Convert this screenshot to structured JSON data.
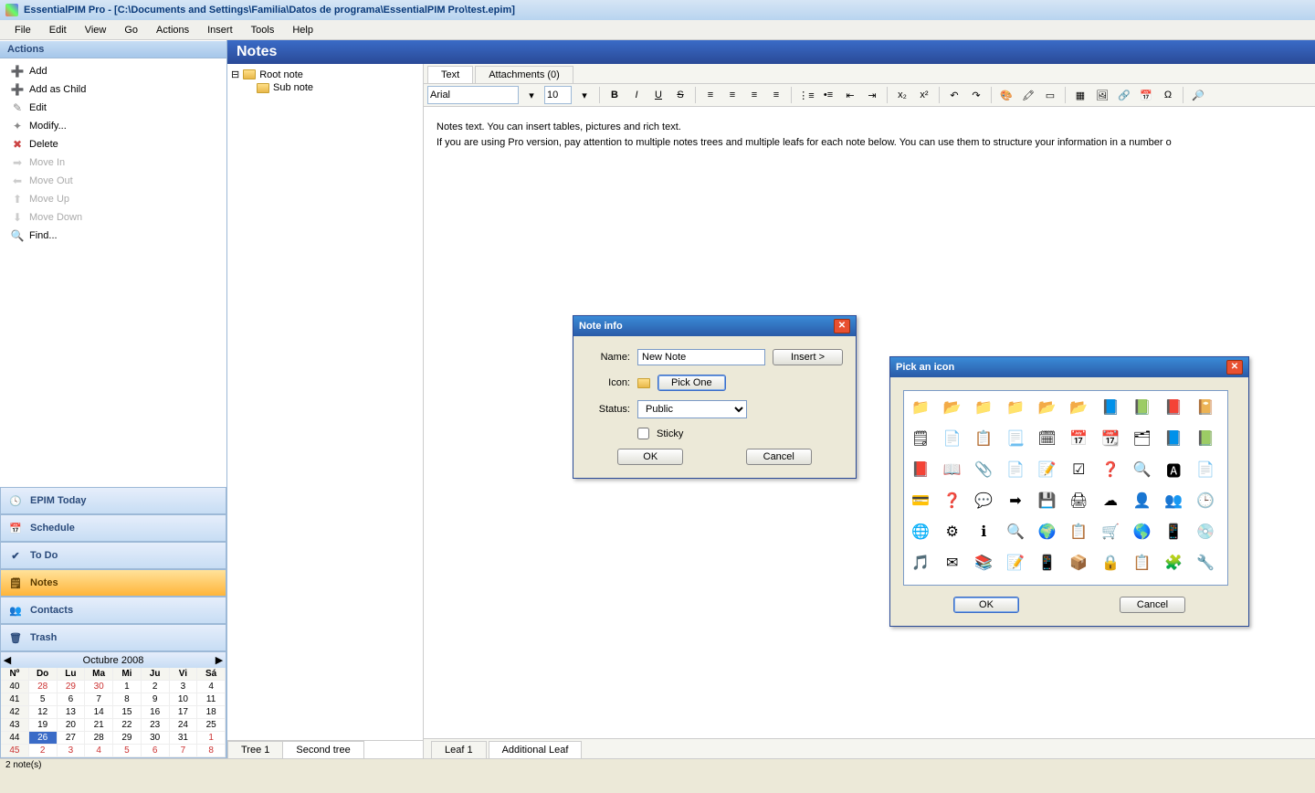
{
  "window": {
    "title": "EssentialPIM Pro - [C:\\Documents and Settings\\Familia\\Datos de programa\\EssentialPIM Pro\\test.epim]"
  },
  "menubar": [
    "File",
    "Edit",
    "View",
    "Go",
    "Actions",
    "Insert",
    "Tools",
    "Help"
  ],
  "actions_header": "Actions",
  "actions": [
    {
      "label": "Add",
      "icon": "➕",
      "disabled": false
    },
    {
      "label": "Add as Child",
      "icon": "➕",
      "disabled": false
    },
    {
      "label": "Edit",
      "icon": "✎",
      "disabled": false
    },
    {
      "label": "Modify...",
      "icon": "✦",
      "disabled": false
    },
    {
      "label": "Delete",
      "icon": "✖",
      "disabled": false
    },
    {
      "label": "Move In",
      "icon": "➡",
      "disabled": true
    },
    {
      "label": "Move Out",
      "icon": "⬅",
      "disabled": true
    },
    {
      "label": "Move Up",
      "icon": "⬆",
      "disabled": true
    },
    {
      "label": "Move Down",
      "icon": "⬇",
      "disabled": true
    },
    {
      "label": "Find...",
      "icon": "🔍",
      "disabled": false
    }
  ],
  "nav": [
    {
      "label": "EPIM Today",
      "icon": "🕓"
    },
    {
      "label": "Schedule",
      "icon": "📅"
    },
    {
      "label": "To Do",
      "icon": "✔"
    },
    {
      "label": "Notes",
      "icon": "🗒",
      "active": true
    },
    {
      "label": "Contacts",
      "icon": "👥"
    },
    {
      "label": "Trash",
      "icon": "🗑"
    }
  ],
  "calendar": {
    "title": "Octubre  2008",
    "dow": [
      "Nº",
      "Do",
      "Lu",
      "Ma",
      "Mi",
      "Ju",
      "Vi",
      "Sá"
    ],
    "rows": [
      [
        "40",
        "28",
        "29",
        "30",
        "1",
        "2",
        "3",
        "4"
      ],
      [
        "41",
        "5",
        "6",
        "7",
        "8",
        "9",
        "10",
        "11"
      ],
      [
        "42",
        "12",
        "13",
        "14",
        "15",
        "16",
        "17",
        "18"
      ],
      [
        "43",
        "19",
        "20",
        "21",
        "22",
        "23",
        "24",
        "25"
      ],
      [
        "44",
        "26",
        "27",
        "28",
        "29",
        "30",
        "31",
        "1"
      ],
      [
        "45",
        "2",
        "3",
        "4",
        "5",
        "6",
        "7",
        "8"
      ]
    ]
  },
  "notes_header": "Notes",
  "tree": {
    "root": "Root note",
    "child": "Sub note"
  },
  "tree_tabs": [
    "Tree 1",
    "Second tree"
  ],
  "editor_tabs": {
    "text": "Text",
    "attachments": "Attachments (0)"
  },
  "toolbar": {
    "font": "Arial",
    "size": "10"
  },
  "editor_body": {
    "line1": "Notes text. You can insert tables, pictures and rich text.",
    "line2": "If you are using Pro version, pay attention to multiple notes trees and multiple leafs for each note below. You can use them to structure your information in a number o"
  },
  "leaf_tabs": [
    "Leaf 1",
    "Additional Leaf"
  ],
  "statusbar": "2 note(s)",
  "dlg_noteinfo": {
    "title": "Note info",
    "name_label": "Name:",
    "name_value": "New Note",
    "insert": "Insert >",
    "icon_label": "Icon:",
    "pickone": "Pick One",
    "status_label": "Status:",
    "status_value": "Public",
    "sticky": "Sticky",
    "ok": "OK",
    "cancel": "Cancel"
  },
  "dlg_pickicon": {
    "title": "Pick an icon",
    "ok": "OK",
    "cancel": "Cancel",
    "icons": [
      "📁",
      "📂",
      "📁",
      "📁",
      "📂",
      "📂",
      "📘",
      "📗",
      "📕",
      "📔",
      "🗒",
      "📄",
      "📋",
      "📃",
      "🗓",
      "📅",
      "📆",
      "🗂",
      "📘",
      "📗",
      "📕",
      "📖",
      "📎",
      "📄",
      "📝",
      "☑",
      "❓",
      "🔍",
      "🅰",
      "📄",
      "💳",
      "❓",
      "💬",
      "➡",
      "💾",
      "🖨",
      "☁",
      "👤",
      "👥",
      "🕒",
      "🌐",
      "⚙",
      "ℹ",
      "🔍",
      "🌍",
      "📋",
      "🛒",
      "🌎",
      "📱",
      "💿",
      "🎵",
      "✉",
      "📚",
      "📝",
      "📱",
      "📦",
      "🔒",
      "📋",
      "🧩",
      "🔧"
    ]
  }
}
